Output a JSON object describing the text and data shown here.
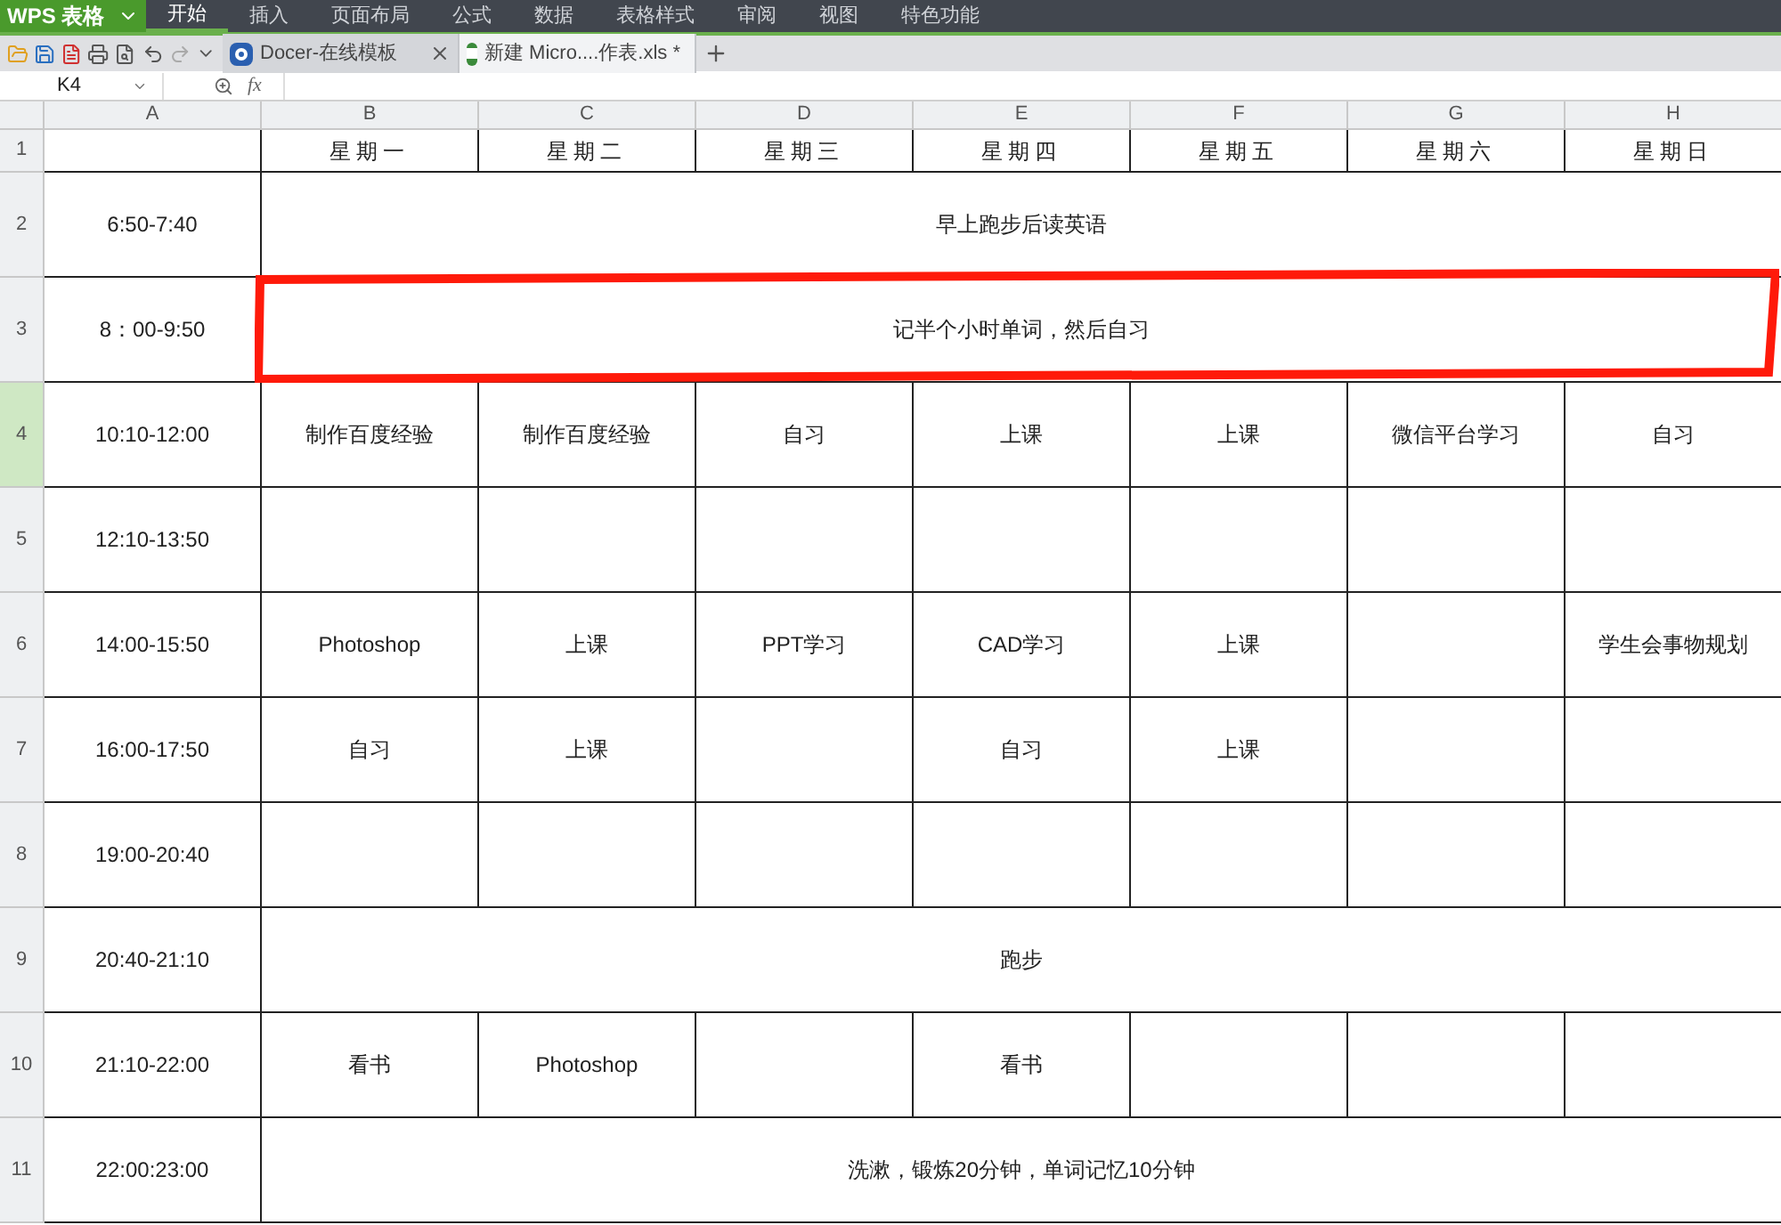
{
  "app_button": {
    "label": "WPS 表格"
  },
  "menu": [
    {
      "label": "开始",
      "selected": true
    },
    {
      "label": "插入",
      "selected": false
    },
    {
      "label": "页面布局",
      "selected": false
    },
    {
      "label": "公式",
      "selected": false
    },
    {
      "label": "数据",
      "selected": false
    },
    {
      "label": "表格样式",
      "selected": false
    },
    {
      "label": "审阅",
      "selected": false
    },
    {
      "label": "视图",
      "selected": false
    },
    {
      "label": "特色功能",
      "selected": false
    }
  ],
  "doc_tabs": [
    {
      "label": "Docer-在线模板",
      "kind": "docer",
      "selected": false
    },
    {
      "label": "新建 Micro....作表.xls *",
      "kind": "sheet",
      "selected": true
    }
  ],
  "name_box": {
    "value": "K4"
  },
  "formula_label": "fx",
  "columns": [
    "A",
    "B",
    "C",
    "D",
    "E",
    "F",
    "G",
    "H"
  ],
  "rows": [
    {
      "number": "1",
      "selected": false,
      "cells": [
        {
          "kind": "blank"
        },
        {
          "kind": "day",
          "text": "星期一"
        },
        {
          "kind": "day",
          "text": "星期二"
        },
        {
          "kind": "day",
          "text": "星期三"
        },
        {
          "kind": "day",
          "text": "星期四"
        },
        {
          "kind": "day",
          "text": "星期五"
        },
        {
          "kind": "day",
          "text": "星期六"
        },
        {
          "kind": "day",
          "text": "星期日"
        }
      ]
    },
    {
      "number": "2",
      "selected": false,
      "cells": [
        {
          "kind": "text",
          "text": "6:50-7:40"
        },
        {
          "kind": "merged",
          "text": "早上跑步后读英语",
          "highlighted": false
        }
      ]
    },
    {
      "number": "3",
      "selected": false,
      "cells": [
        {
          "kind": "text",
          "text": "8：00-9:50"
        },
        {
          "kind": "merged",
          "text": "记半个小时单词，然后自习",
          "highlighted": true
        }
      ]
    },
    {
      "number": "4",
      "selected": true,
      "cells": [
        {
          "kind": "text",
          "text": "10:10-12:00"
        },
        {
          "kind": "text",
          "text": "制作百度经验"
        },
        {
          "kind": "text",
          "text": "制作百度经验"
        },
        {
          "kind": "text",
          "text": "自习"
        },
        {
          "kind": "text",
          "text": "上课"
        },
        {
          "kind": "text",
          "text": "上课"
        },
        {
          "kind": "text",
          "text": "微信平台学习"
        },
        {
          "kind": "text",
          "text": "自习"
        }
      ]
    },
    {
      "number": "5",
      "selected": false,
      "cells": [
        {
          "kind": "text",
          "text": "12:10-13:50"
        },
        {
          "kind": "blank"
        },
        {
          "kind": "blank"
        },
        {
          "kind": "blank"
        },
        {
          "kind": "blank"
        },
        {
          "kind": "blank"
        },
        {
          "kind": "blank"
        },
        {
          "kind": "blank"
        }
      ]
    },
    {
      "number": "6",
      "selected": false,
      "cells": [
        {
          "kind": "text",
          "text": "14:00-15:50"
        },
        {
          "kind": "text",
          "text": "Photoshop"
        },
        {
          "kind": "text",
          "text": "上课"
        },
        {
          "kind": "text",
          "text": "PPT学习"
        },
        {
          "kind": "text",
          "text": "CAD学习"
        },
        {
          "kind": "text",
          "text": "上课"
        },
        {
          "kind": "blank"
        },
        {
          "kind": "text",
          "text": "学生会事物规划"
        }
      ]
    },
    {
      "number": "7",
      "selected": false,
      "cells": [
        {
          "kind": "text",
          "text": "16:00-17:50"
        },
        {
          "kind": "text",
          "text": "自习"
        },
        {
          "kind": "text",
          "text": "上课"
        },
        {
          "kind": "blank"
        },
        {
          "kind": "text",
          "text": "自习"
        },
        {
          "kind": "text",
          "text": "上课"
        },
        {
          "kind": "blank"
        },
        {
          "kind": "blank"
        }
      ]
    },
    {
      "number": "8",
      "selected": false,
      "cells": [
        {
          "kind": "text",
          "text": "19:00-20:40"
        },
        {
          "kind": "blank"
        },
        {
          "kind": "blank"
        },
        {
          "kind": "blank"
        },
        {
          "kind": "blank"
        },
        {
          "kind": "blank"
        },
        {
          "kind": "blank"
        },
        {
          "kind": "blank"
        }
      ]
    },
    {
      "number": "9",
      "selected": false,
      "cells": [
        {
          "kind": "text",
          "text": "20:40-21:10"
        },
        {
          "kind": "merged",
          "text": "跑步",
          "highlighted": false
        }
      ]
    },
    {
      "number": "10",
      "selected": false,
      "cells": [
        {
          "kind": "text",
          "text": "21:10-22:00"
        },
        {
          "kind": "text",
          "text": "看书"
        },
        {
          "kind": "text",
          "text": "Photoshop"
        },
        {
          "kind": "blank"
        },
        {
          "kind": "text",
          "text": "看书"
        },
        {
          "kind": "blank"
        },
        {
          "kind": "blank"
        },
        {
          "kind": "blank"
        }
      ]
    },
    {
      "number": "11",
      "selected": false,
      "cells": [
        {
          "kind": "text",
          "text": "22:00:23:00"
        },
        {
          "kind": "merged",
          "text": "洗漱，锻炼20分钟，单词记忆10分钟",
          "highlighted": false
        }
      ]
    }
  ]
}
